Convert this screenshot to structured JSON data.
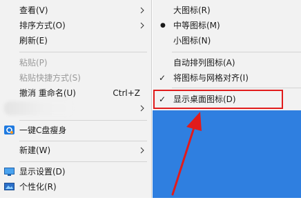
{
  "main_menu": {
    "items": [
      {
        "label": "查看(V)"
      },
      {
        "label": "排序方式(O)"
      },
      {
        "label": "刷新(E)"
      },
      {
        "label": "粘贴(P)"
      },
      {
        "label": "粘贴快捷方式(S)"
      },
      {
        "label": "撤消 重命名(U)",
        "shortcut": "Ctrl+Z"
      },
      {
        "label": "一键C盘瘦身"
      },
      {
        "label": "新建(W)"
      },
      {
        "label": "显示设置(D)"
      },
      {
        "label": "个性化(R)"
      }
    ]
  },
  "sub_menu": {
    "items": [
      {
        "label": "大图标(R)"
      },
      {
        "label": "中等图标(M)",
        "marker": "●"
      },
      {
        "label": "小图标(N)"
      },
      {
        "label": "自动排列图标(A)"
      },
      {
        "label": "将图标与网格对齐(I)",
        "marker": "✓"
      },
      {
        "label": "显示桌面图标(D)",
        "marker": "✓"
      }
    ]
  },
  "colors": {
    "menu_bg": "#f2f2f2",
    "highlight": "#e11b1b",
    "desktop": "#2f7fe0"
  }
}
